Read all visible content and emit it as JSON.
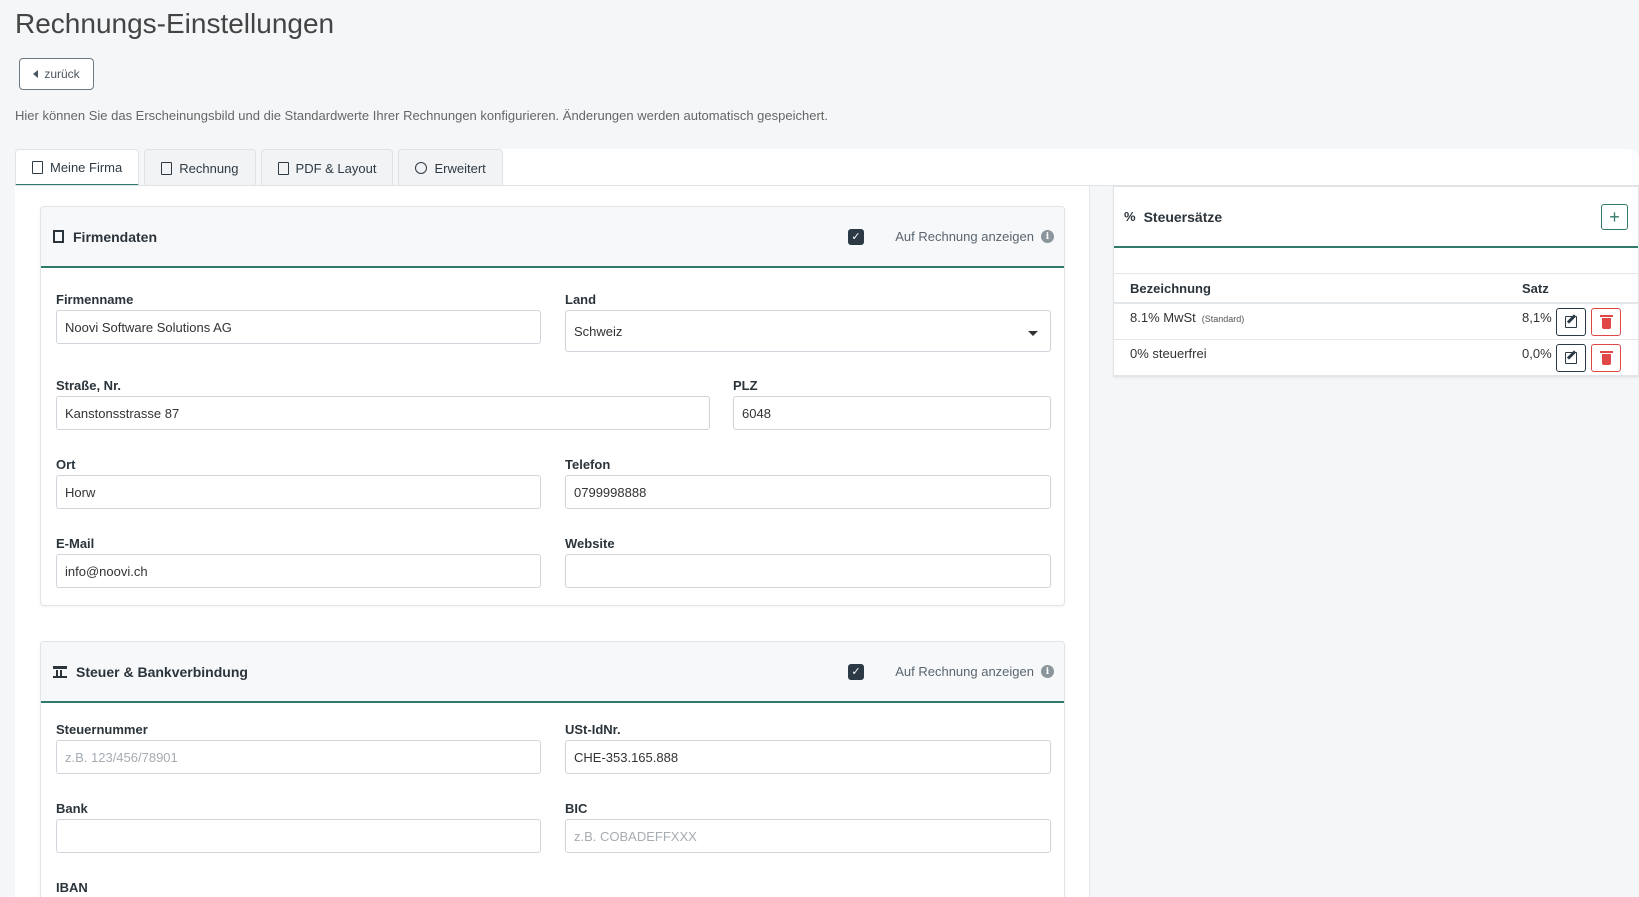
{
  "page": {
    "title": "Rechnungs-Einstellungen",
    "back_label": "zurück",
    "intro": "Hier können Sie das Erscheinungsbild und die Standardwerte Ihrer Rechnungen konfigurieren. Änderungen werden automatisch gespeichert."
  },
  "tabs": [
    {
      "label": "Meine Firma",
      "icon": "building-icon",
      "active": true
    },
    {
      "label": "Rechnung",
      "icon": "file-icon",
      "active": false
    },
    {
      "label": "PDF & Layout",
      "icon": "pdf-icon",
      "active": false
    },
    {
      "label": "Erweitert",
      "icon": "cogs-icon",
      "active": false
    }
  ],
  "firmendaten": {
    "title": "Firmendaten",
    "show_label": "Auf Rechnung anzeigen",
    "show_checked": true,
    "fields": {
      "firmenname": {
        "label": "Firmenname",
        "value": "Noovi Software Solutions AG"
      },
      "land": {
        "label": "Land",
        "value": "Schweiz"
      },
      "strasse": {
        "label": "Straße, Nr.",
        "value": "Kanstonsstrasse 87"
      },
      "plz": {
        "label": "PLZ",
        "value": "6048"
      },
      "ort": {
        "label": "Ort",
        "value": "Horw"
      },
      "telefon": {
        "label": "Telefon",
        "value": "0799998888"
      },
      "email": {
        "label": "E-Mail",
        "value": "info@noovi.ch"
      },
      "website": {
        "label": "Website",
        "value": ""
      }
    }
  },
  "steuer": {
    "title": "Steuer & Bankverbindung",
    "show_label": "Auf Rechnung anzeigen",
    "show_checked": true,
    "fields": {
      "steuernummer": {
        "label": "Steuernummer",
        "value": "",
        "placeholder": "z.B. 123/456/78901"
      },
      "ustid": {
        "label": "USt-IdNr.",
        "value": "CHE-353.165.888"
      },
      "bank": {
        "label": "Bank",
        "value": ""
      },
      "bic": {
        "label": "BIC",
        "value": "",
        "placeholder": "z.B. COBADEFFXXX"
      },
      "iban": {
        "label": "IBAN"
      }
    }
  },
  "steuersaetze": {
    "title": "Steuersätze",
    "add_label": "+",
    "col_name": "Bezeichnung",
    "col_rate": "Satz",
    "rows": [
      {
        "name": "8.1% MwSt",
        "tag": "(Standard)",
        "rate": "8,1%"
      },
      {
        "name": "0% steuerfrei",
        "tag": "",
        "rate": "0,0%"
      }
    ]
  },
  "colors": {
    "accent": "#2f7a6b",
    "danger": "#e04848",
    "dark": "#2b3a45"
  }
}
